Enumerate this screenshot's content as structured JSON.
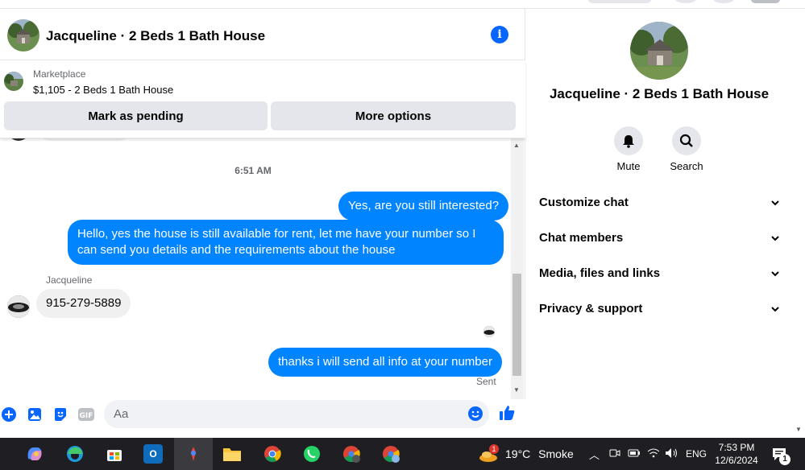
{
  "chat": {
    "title": "Jacqueline · 2 Beds 1 Bath House",
    "marketplace": {
      "label": "Marketplace",
      "item": "$1,105 - 2 Beds 1 Bath House",
      "buttons": {
        "pending": "Mark as pending",
        "more": "More options"
      }
    },
    "timestamp": "6:51 AM",
    "messages": [
      {
        "from": "me",
        "text": "Yes, are you still interested?"
      },
      {
        "from": "me",
        "text": "Hello, yes the house is still available for rent, let me have your number so I can send you details and the requirements about the house"
      },
      {
        "from": "them",
        "sender": "Jacqueline",
        "text": "915-279-5889"
      },
      {
        "from": "me",
        "text": "thanks i will send all info at your number"
      }
    ],
    "status": "Sent",
    "composer": {
      "placeholder": "Aa"
    }
  },
  "panel": {
    "title": "Jacqueline · 2 Beds 1 Bath House",
    "actions": [
      {
        "label": "Mute",
        "icon": "bell-icon"
      },
      {
        "label": "Search",
        "icon": "search-icon"
      }
    ],
    "sections": [
      "Customize chat",
      "Chat members",
      "Media, files and links",
      "Privacy & support"
    ]
  },
  "taskbar": {
    "weather": {
      "badge": "1",
      "temp": "19°C",
      "condition": "Smoke"
    },
    "language": "ENG",
    "time": "7:53 PM",
    "date": "12/6/2024",
    "notification_count": "1"
  },
  "colors": {
    "accent": "#0084ff",
    "brand_blue": "#0866ff",
    "bubble_in": "#f0f0f0",
    "taskbar": "#1f1f23"
  }
}
